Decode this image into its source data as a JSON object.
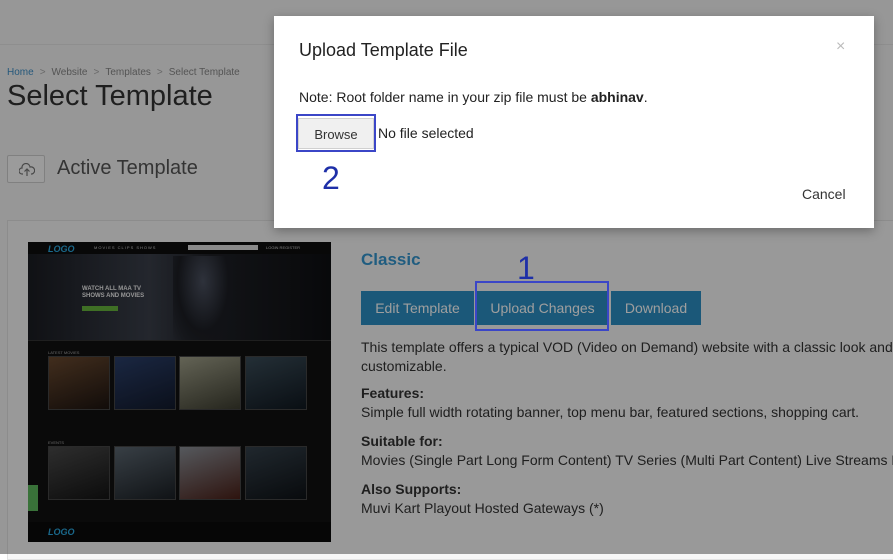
{
  "breadcrumb": [
    "Home",
    "Website",
    "Templates",
    "Select Template"
  ],
  "page_title": "Select Template",
  "section": {
    "title": "Active Template",
    "icon": "cloud-upload-icon"
  },
  "template": {
    "name": "Classic",
    "buttons": {
      "edit": "Edit Template",
      "upload": "Upload Changes",
      "download": "Download"
    },
    "description": "This template offers a typical VOD (Video on Demand) website with a classic look and customizable.",
    "features_label": "Features:",
    "features": "Simple full width rotating banner, top menu bar, featured sections, shopping cart.",
    "suitable_label": "Suitable for:",
    "suitable": "Movies (Single Part Long Form Content) TV Series (Multi Part Content) Live Streams F",
    "supports_label": "Also Supports:",
    "supports": "Muvi Kart Playout Hosted Gateways (*)",
    "preview": {
      "logo": "LOGO",
      "menu": "MOVIES  CLIPS  SHOWS",
      "login": "LOGIN  REGISTER",
      "banner_line1": "WATCH ALL MAA TV",
      "banner_line2": "SHOWS AND MOVIES",
      "row1": "LATEST MOVIES",
      "row2": "EVENTS",
      "footer_logo": "LOGO"
    }
  },
  "modal": {
    "title": "Upload Template File",
    "close": "×",
    "note_prefix": "Note: Root folder name in your zip file must be ",
    "note_bold": "abhinav",
    "note_suffix": ".",
    "browse": "Browse",
    "file_status": "No file selected",
    "cancel": "Cancel"
  },
  "annotations": {
    "step1": "1",
    "step2": "2",
    "highlight_color": "#3b46c7"
  },
  "colors": {
    "accent": "#2c8fc4",
    "link": "#3596cf",
    "overlay": "rgba(0,0,0,0.38)"
  }
}
